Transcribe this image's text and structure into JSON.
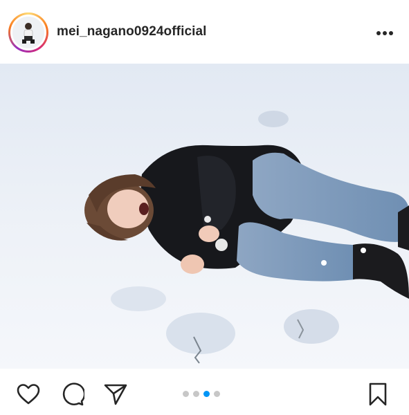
{
  "post": {
    "username": "mei_nagano0924official"
  },
  "header": {
    "avatar_icon": "profile-avatar",
    "more_icon": "more-options-icon"
  },
  "actions": {
    "like_icon": "heart-icon",
    "comment_icon": "comment-icon",
    "share_icon": "send-icon",
    "save_icon": "bookmark-icon"
  },
  "carousel": {
    "total": 4,
    "current": 3
  },
  "colors": {
    "accent": "#0095f6",
    "inactive_dot": "#c7c7c7",
    "text": "#262626"
  }
}
